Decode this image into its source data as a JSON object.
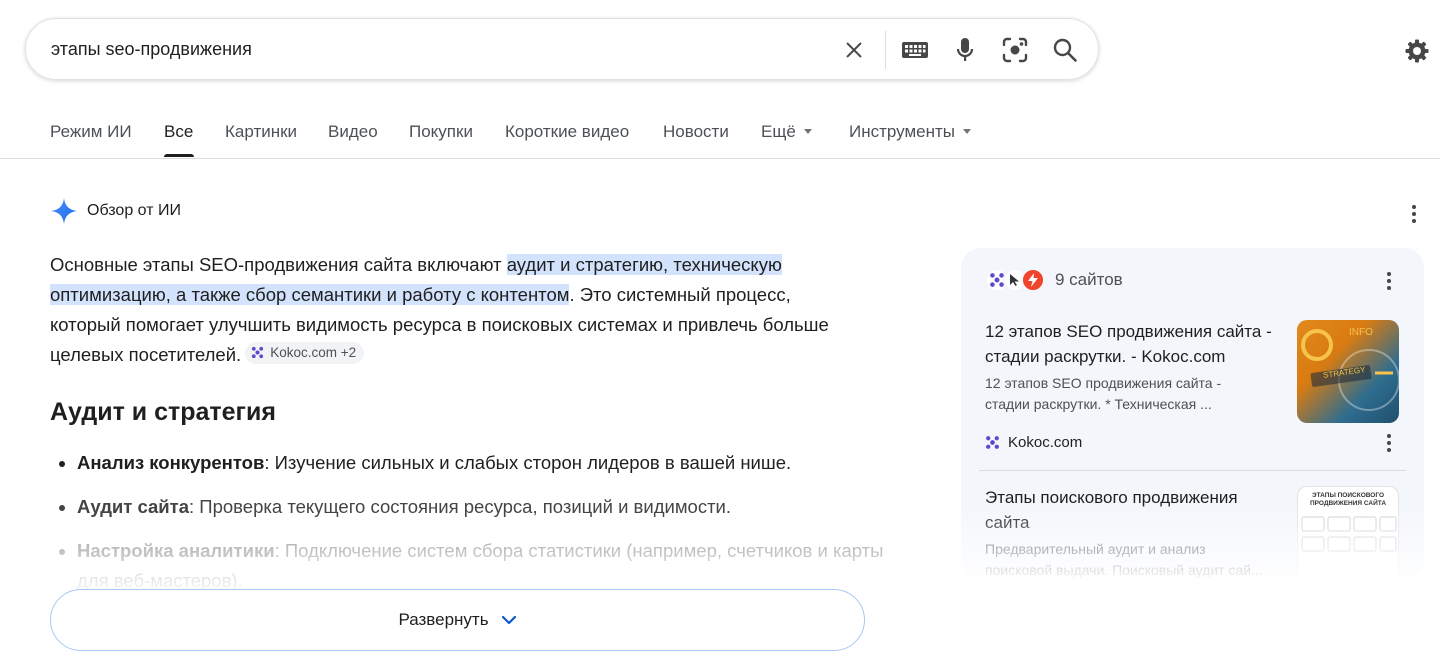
{
  "search": {
    "query": "этапы seo-продвижения"
  },
  "tabs": [
    {
      "label": "Режим ИИ"
    },
    {
      "label": "Все"
    },
    {
      "label": "Картинки"
    },
    {
      "label": "Видео"
    },
    {
      "label": "Покупки"
    },
    {
      "label": "Короткие видео"
    },
    {
      "label": "Новости"
    },
    {
      "label": "Ещё"
    },
    {
      "label": "Инструменты"
    }
  ],
  "ai_overview": {
    "title": "Обзор от ИИ",
    "summary_before": "Основные этапы SEO-продвижения сайта включают ",
    "summary_highlight": "аудит и стратегию, техническую оптимизацию, а также сбор семантики и работу с контентом",
    "summary_after": ". Это системный процесс, который помогает улучшить видимость ресурса в поисковых системах и привлечь больше целевых посетителей.",
    "source_chip": "Kokoc.com +2",
    "section_title": "Аудит и стратегия",
    "bullets": [
      {
        "term": "Анализ конкурентов",
        "text": ": Изучение сильных и слабых сторон лидеров в вашей нише."
      },
      {
        "term": "Аудит сайта",
        "text": ": Проверка текущего состояния ресурса, позиций и видимости."
      },
      {
        "term": "Настройка аналитики",
        "text": ": Подключение систем сбора статистики (например, счетчиков и карты для веб-мастеров)."
      }
    ],
    "expand_label": "Развернуть"
  },
  "sources": {
    "count_label": "9 сайтов",
    "cards": [
      {
        "title": "12 этапов SEO продвижения сайта - стадии раскрутки. - Kokoc.com",
        "snippet": "12 этапов SEO продвижения сайта - стадии раскрутки. * Техническая ...",
        "site": "Kokoc.com",
        "thumb_text_1": "INFO",
        "thumb_text_2": "STRATEGY"
      },
      {
        "title": "Этапы поискового продвижения сайта",
        "snippet": "Предварительный аудит и анализ поисковой выдачи. Поисковый аудит сай...",
        "thumb_text_1": "ЭТАПЫ ПОИСКОВОГО",
        "thumb_text_2": "ПРОДВИЖЕНИЯ САЙТА"
      }
    ]
  },
  "colors": {
    "highlight": "#d3e3fd",
    "expand_border": "#a8c7fa",
    "sources_bg": "#f3f6fb",
    "kokoc_purple": "#5b4ccf",
    "yandex_red": "#f0442c",
    "gemini_blue": "#4285f4"
  }
}
